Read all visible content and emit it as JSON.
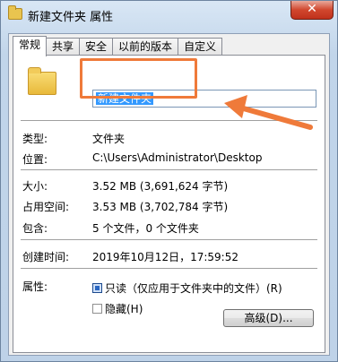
{
  "window": {
    "title": "新建文件夹 属性",
    "close_label": "✕"
  },
  "tabs": [
    {
      "label": "常规"
    },
    {
      "label": "共享"
    },
    {
      "label": "安全"
    },
    {
      "label": "以前的版本"
    },
    {
      "label": "自定义"
    }
  ],
  "general": {
    "name_value": "新建文件夹",
    "type_label": "类型:",
    "type_value": "文件夹",
    "location_label": "位置:",
    "location_value": "C:\\Users\\Administrator\\Desktop",
    "size_label": "大小:",
    "size_value": "3.52 MB (3,691,624 字节)",
    "disk_size_label": "占用空间:",
    "disk_size_value": "3.53 MB (3,702,784 字节)",
    "contains_label": "包含:",
    "contains_value": "5 个文件，0 个文件夹",
    "created_label": "创建时间:",
    "created_value": "2019年10月12日，17:59:52",
    "attributes_label": "属性:",
    "readonly_label": "只读（仅应用于文件夹中的文件）(R)",
    "readonly_checked": true,
    "hidden_label": "隐藏(H)",
    "hidden_checked": false,
    "advanced_button": "高级(D)..."
  },
  "colors": {
    "annotation": "#ef7a3a",
    "selection": "#3399ff"
  },
  "icons": {
    "title": "folder-icon",
    "large": "folder-icon"
  }
}
